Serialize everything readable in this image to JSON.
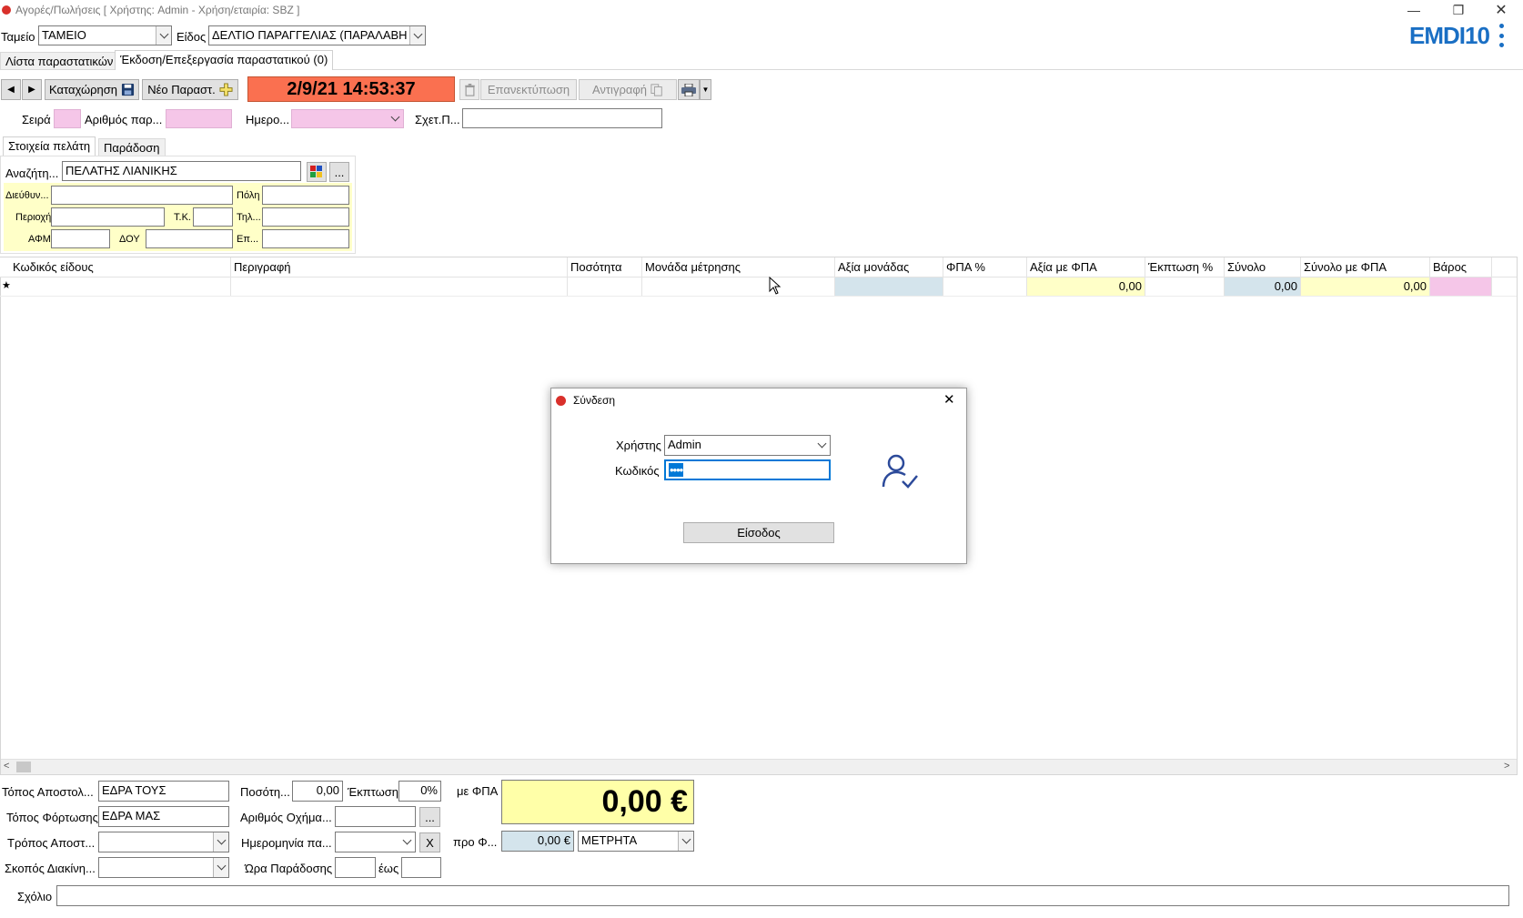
{
  "window": {
    "title": "Αγορές/Πωλήσεις  [ Χρήστης: Admin - Χρήση/εταιρία: SBZ ]",
    "logo": "EMDI10"
  },
  "header": {
    "tameio_label": "Ταμείο",
    "tameio_value": "ΤΑΜΕΙΟ",
    "eidos_label": "Είδος",
    "eidos_value": "ΔΕΛΤΙΟ ΠΑΡΑΓΓΕΛΙΑΣ (ΠΑΡΑΛΑΒΗ"
  },
  "tabs": [
    {
      "label": "Λίστα παραστατικών"
    },
    {
      "label": "Έκδοση/Επεξεργασία παραστατικού (0)"
    }
  ],
  "toolbar": {
    "save_label": "Καταχώρηση",
    "new_label": "Νέο Παραστ.",
    "datetime": "2/9/21 14:53:37",
    "reprint_label": "Επανεκτύπωση",
    "copy_label": "Αντιγραφή"
  },
  "doc": {
    "seira_label": "Σειρά",
    "arithmos_label": "Αριθμός παρ...",
    "imero_label": "Ημερο...",
    "sxet_label": "Σχετ.Π..."
  },
  "customer_tabs": [
    {
      "label": "Στοιχεία πελάτη"
    },
    {
      "label": "Παράδοση"
    }
  ],
  "customer": {
    "search_label": "Αναζήτη...",
    "search_value": "ΠΕΛΑΤΗΣ ΛΙΑΝΙΚΗΣ",
    "more_label": "...",
    "address_label": "Διεύθυν...",
    "city_label": "Πόλη",
    "area_label": "Περιοχή",
    "tk_label": "Τ.Κ.",
    "phone_label": "Τηλ...",
    "afm_label": "ΑΦΜ",
    "doy_label": "ΔΟΥ",
    "ep_label": "Επ..."
  },
  "grid": {
    "columns": [
      "Κωδικός είδους",
      "Περιγραφή",
      "Ποσότητα",
      "Μονάδα μέτρησης",
      "Αξία μονάδας",
      "ΦΠΑ %",
      "Αξία με ΦΠΑ",
      "Έκπτωση %",
      "Σύνολο",
      "Σύνολο με ΦΠΑ",
      "Βάρος"
    ],
    "new_row_marker": "★",
    "row": {
      "value_with_vat": "0,00",
      "total": "0,00",
      "total_with_vat": "0,00"
    }
  },
  "footer": {
    "topos_apostolis_label": "Τόπος Αποστολ...",
    "topos_apostolis_value": "ΕΔΡΑ ΤΟΥΣ",
    "topos_fortosis_label": "Τόπος Φόρτωσης",
    "topos_fortosis_value": "ΕΔΡΑ ΜΑΣ",
    "tropos_label": "Τρόπος Αποστ...",
    "skopos_label": "Σκοπός Διακίνη...",
    "posotita_label": "Ποσότη...",
    "posotita_value": "0,00",
    "ekptosi_label": "Έκπτωση",
    "ekptosi_value": "0%",
    "oxima_label": "Αριθμός Οχήμα...",
    "oxima_more": "...",
    "imerominia_label": "Ημερομηνία πα...",
    "clear_label": "X",
    "ora_label": "Ώρα Παράδοσης",
    "eos_label": "έως",
    "me_fpa_label": "με ΦΠΑ",
    "total": "0,00 €",
    "pro_fpa_label": "προ Φ...",
    "pro_fpa_value": "0,00 €",
    "payment_value": "ΜΕΤΡΗΤΑ",
    "comment_label": "Σχόλιο"
  },
  "login_dialog": {
    "title": "Σύνδεση",
    "user_label": "Χρήστης",
    "user_value": "Admin",
    "password_label": "Κωδικός",
    "password_value": "••••",
    "login_button": "Είσοδος"
  },
  "colors": {
    "datetime_bg": "#fa7050",
    "pink_field": "#f5c6e8",
    "yellow_panel": "#ffffc8",
    "total_bg": "#ffffa8",
    "blue_cell": "#d4e4ec",
    "accent": "#0078d7",
    "logo": "#1a6fc4"
  }
}
